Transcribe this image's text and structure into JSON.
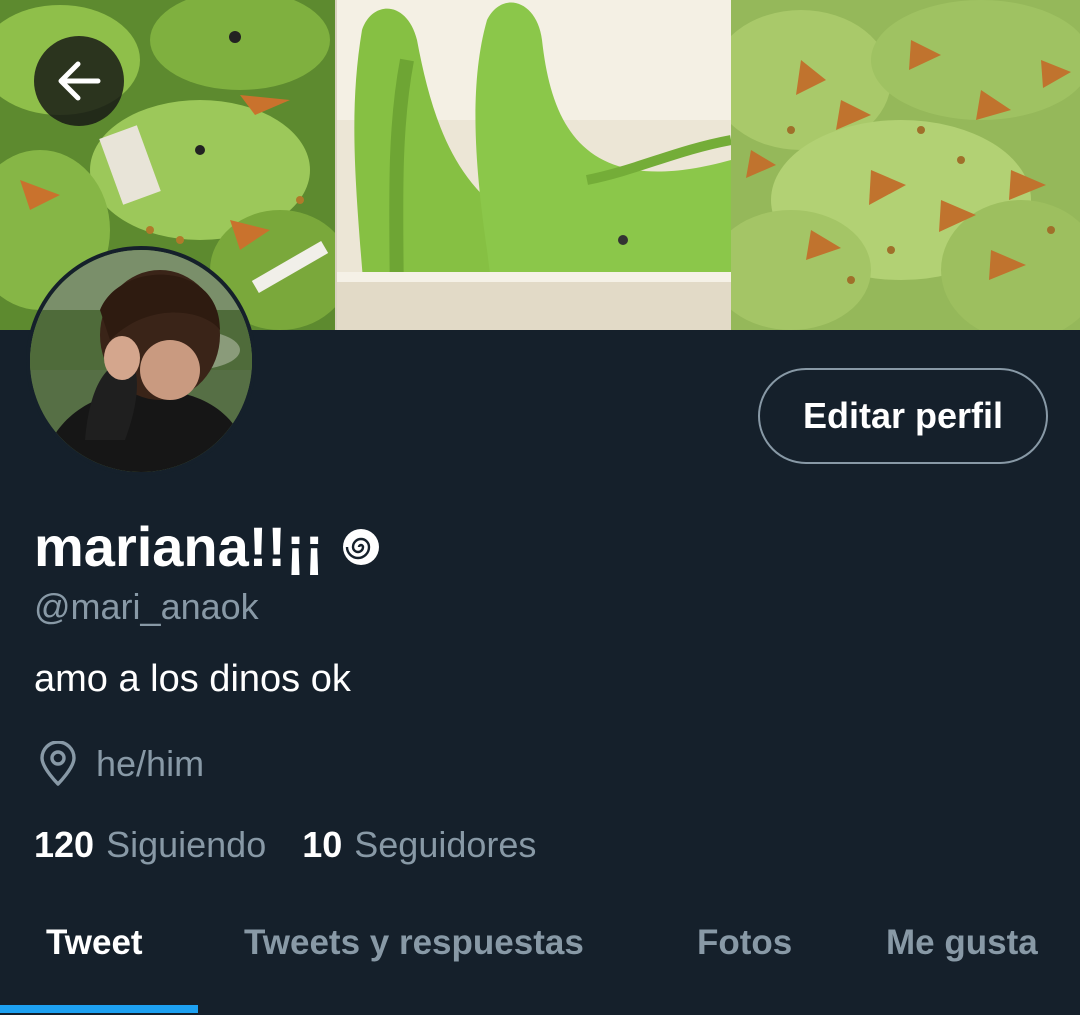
{
  "profile": {
    "display_name": "mariana!!¡¡",
    "name_emoji": "swirl-icon",
    "handle": "@mari_anaok",
    "bio": "amo a los dinos ok",
    "location": "he/him",
    "edit_label": "Editar perfil"
  },
  "stats": {
    "following_count": "120",
    "following_label": "Siguiendo",
    "followers_count": "10",
    "followers_label": "Seguidores"
  },
  "tabs": [
    {
      "label": "Tweet",
      "active": true
    },
    {
      "label": "Tweets y respuestas",
      "active": false
    },
    {
      "label": "Fotos",
      "active": false
    },
    {
      "label": "Me gusta",
      "active": false
    }
  ],
  "colors": {
    "background": "#15202b",
    "secondary_text": "#8899a6",
    "accent": "#1da1f2"
  }
}
